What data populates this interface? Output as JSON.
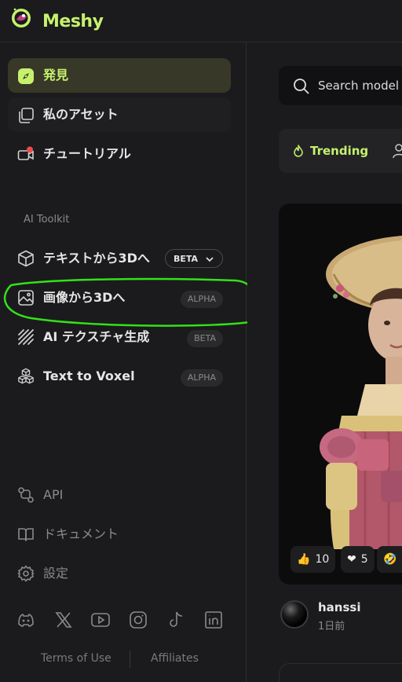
{
  "brand": {
    "name": "Meshy",
    "accent": "#c6f16d"
  },
  "nav": {
    "items": [
      {
        "label": "発見",
        "icon": "compass-icon",
        "active": true
      },
      {
        "label": "私のアセット",
        "icon": "assets-icon",
        "active": false
      },
      {
        "label": "チュートリアル",
        "icon": "video-camera-icon",
        "active": false,
        "notification_dot": true
      }
    ]
  },
  "toolkit": {
    "title": "AI Toolkit",
    "items": [
      {
        "label": "テキストから3Dへ",
        "icon": "cube-icon",
        "badge": "BETA",
        "badge_dropdown": true
      },
      {
        "label": "画像から3Dへ",
        "icon": "image-icon",
        "badge": "ALPHA"
      },
      {
        "label": "AI テクスチャ生成",
        "icon": "stripes-icon",
        "badge": "BETA"
      },
      {
        "label": "Text to Voxel",
        "icon": "voxel-cubes-icon",
        "badge": "ALPHA"
      }
    ]
  },
  "footer_nav": {
    "items": [
      {
        "label": "API",
        "icon": "api-icon"
      },
      {
        "label": "ドキュメント",
        "icon": "book-icon"
      },
      {
        "label": "設定",
        "icon": "gear-icon"
      }
    ]
  },
  "social": [
    "discord-icon",
    "x-icon",
    "youtube-icon",
    "instagram-icon",
    "tiktok-icon",
    "linkedin-icon"
  ],
  "links": {
    "terms": "Terms of Use",
    "affiliates": "Affiliates"
  },
  "main": {
    "search_placeholder": "Search model / c",
    "tabs": {
      "trending": "Trending"
    },
    "card": {
      "reactions": [
        {
          "emoji": "👍",
          "count": "10"
        },
        {
          "emoji": "❤",
          "count": "5"
        },
        {
          "emoji": "🤣",
          "count": ""
        }
      ]
    },
    "author": {
      "name": "hanssi",
      "time": "1日前"
    }
  }
}
